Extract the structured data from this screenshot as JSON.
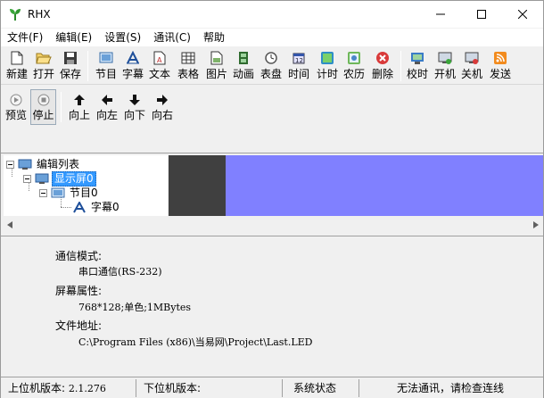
{
  "window": {
    "title": "RHX"
  },
  "menu": [
    "文件(F)",
    "编辑(E)",
    "设置(S)",
    "通讯(C)",
    "帮助"
  ],
  "toolbar": {
    "new": "新建",
    "open": "打开",
    "save": "保存",
    "program": "节目",
    "subtitle": "字幕",
    "text": "文本",
    "table": "表格",
    "picture": "图片",
    "animation": "动画",
    "dial": "表盘",
    "time": "时间",
    "timer": "计时",
    "lunar": "农历",
    "delete": "删除",
    "sync_time": "校时",
    "power_on": "开机",
    "power_off": "关机",
    "send": "发送"
  },
  "toolbar2": {
    "preview": "预览",
    "stop": "停止",
    "up": "向上",
    "left": "向左",
    "down": "向下",
    "right": "向右"
  },
  "tree": {
    "root": "编辑列表",
    "screen": "显示屏0",
    "program": "节目0",
    "subtitle": "字幕0"
  },
  "info": {
    "comm_mode_label": "通信模式:",
    "comm_mode_value": "串口通信(RS-232)",
    "screen_attr_label": "屏幕属性:",
    "screen_attr_value": "768*128;单色;1MBytes",
    "file_path_label": "文件地址:",
    "file_path_value": "C:\\Program Files (x86)\\当易网\\Project\\Last.LED"
  },
  "status": {
    "host_version_label": "上位机版本:",
    "host_version": "2.1.276",
    "device_version_label": "下位机版本:",
    "system_status": "系统状态",
    "comm_status": "无法通讯，请检查连线"
  },
  "colors": {
    "preview_screen": "#8080ff",
    "preview_dark": "#404040",
    "selection": "#3399ff"
  }
}
